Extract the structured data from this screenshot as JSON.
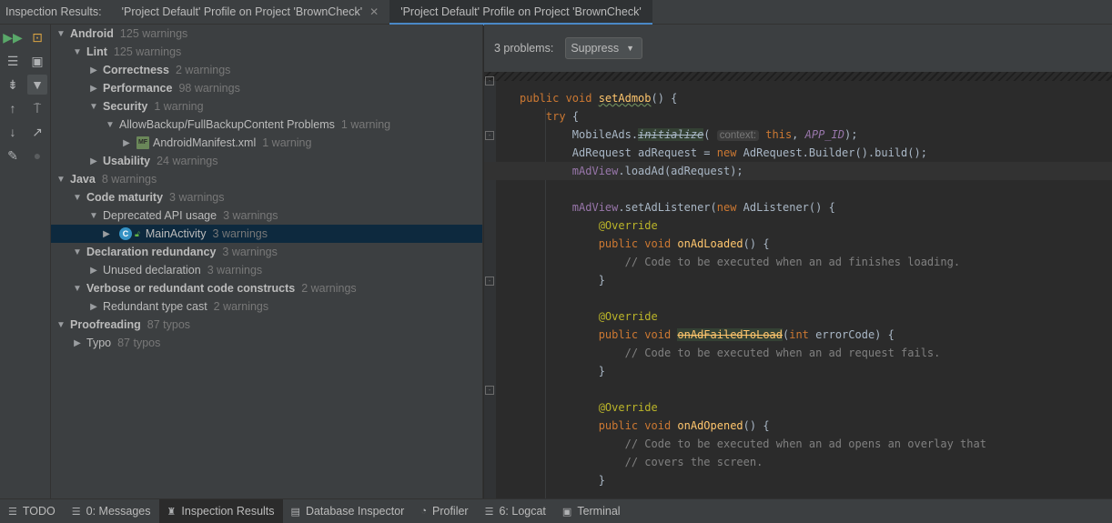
{
  "tabbar": {
    "title": "Inspection Results:",
    "tabs": [
      {
        "label": "'Project Default' Profile on Project 'BrownCheck'",
        "close": "✕"
      },
      {
        "label": "'Project Default' Profile on Project 'BrownCheck'"
      }
    ]
  },
  "toolstrip": {
    "icons": [
      "rerun-icon",
      "export-icon",
      "expand-all-icon",
      "collapse-all-icon",
      "filter-icon",
      "previous-icon",
      "next-icon",
      "settings-icon",
      "preview-icon",
      "autoscroll-icon",
      "fix-icon",
      "lightbulb-icon"
    ]
  },
  "tree": {
    "rows": [
      {
        "label": "Android",
        "count": "125 warnings"
      },
      {
        "label": "Lint",
        "count": "125 warnings"
      },
      {
        "label": "Correctness",
        "count": "2 warnings"
      },
      {
        "label": "Performance",
        "count": "98 warnings"
      },
      {
        "label": "Security",
        "count": "1 warning"
      },
      {
        "label": "AllowBackup/FullBackupContent Problems",
        "count": "1 warning"
      },
      {
        "label": "AndroidManifest.xml",
        "count": "1 warning"
      },
      {
        "label": "Usability",
        "count": "24 warnings"
      },
      {
        "label": "Java",
        "count": "8 warnings"
      },
      {
        "label": "Code maturity",
        "count": "3 warnings"
      },
      {
        "label": "Deprecated API usage",
        "count": "3 warnings"
      },
      {
        "label": "MainActivity",
        "count": "3 warnings"
      },
      {
        "label": "Declaration redundancy",
        "count": "3 warnings"
      },
      {
        "label": "Unused declaration",
        "count": "3 warnings"
      },
      {
        "label": "Verbose or redundant code constructs",
        "count": "2 warnings"
      },
      {
        "label": "Redundant type cast",
        "count": "2 warnings"
      },
      {
        "label": "Proofreading",
        "count": "87 typos"
      },
      {
        "label": "Typo",
        "count": "87 typos"
      }
    ]
  },
  "problems": {
    "count_label": "3 problems:",
    "suppress_label": "Suppress"
  },
  "code": {
    "hint": "context:"
  },
  "bottombar": {
    "tabs": [
      "TODO",
      "0: Messages",
      "Inspection Results",
      "Database Inspector",
      "Profiler",
      "6: Logcat",
      "Terminal"
    ]
  },
  "colors": {
    "accent": "#4a88c7",
    "selection": "#0d293e",
    "keyword": "#cc7832",
    "function": "#ffc66d",
    "field": "#9876aa",
    "annotation": "#bbb529",
    "comment": "#808080"
  }
}
